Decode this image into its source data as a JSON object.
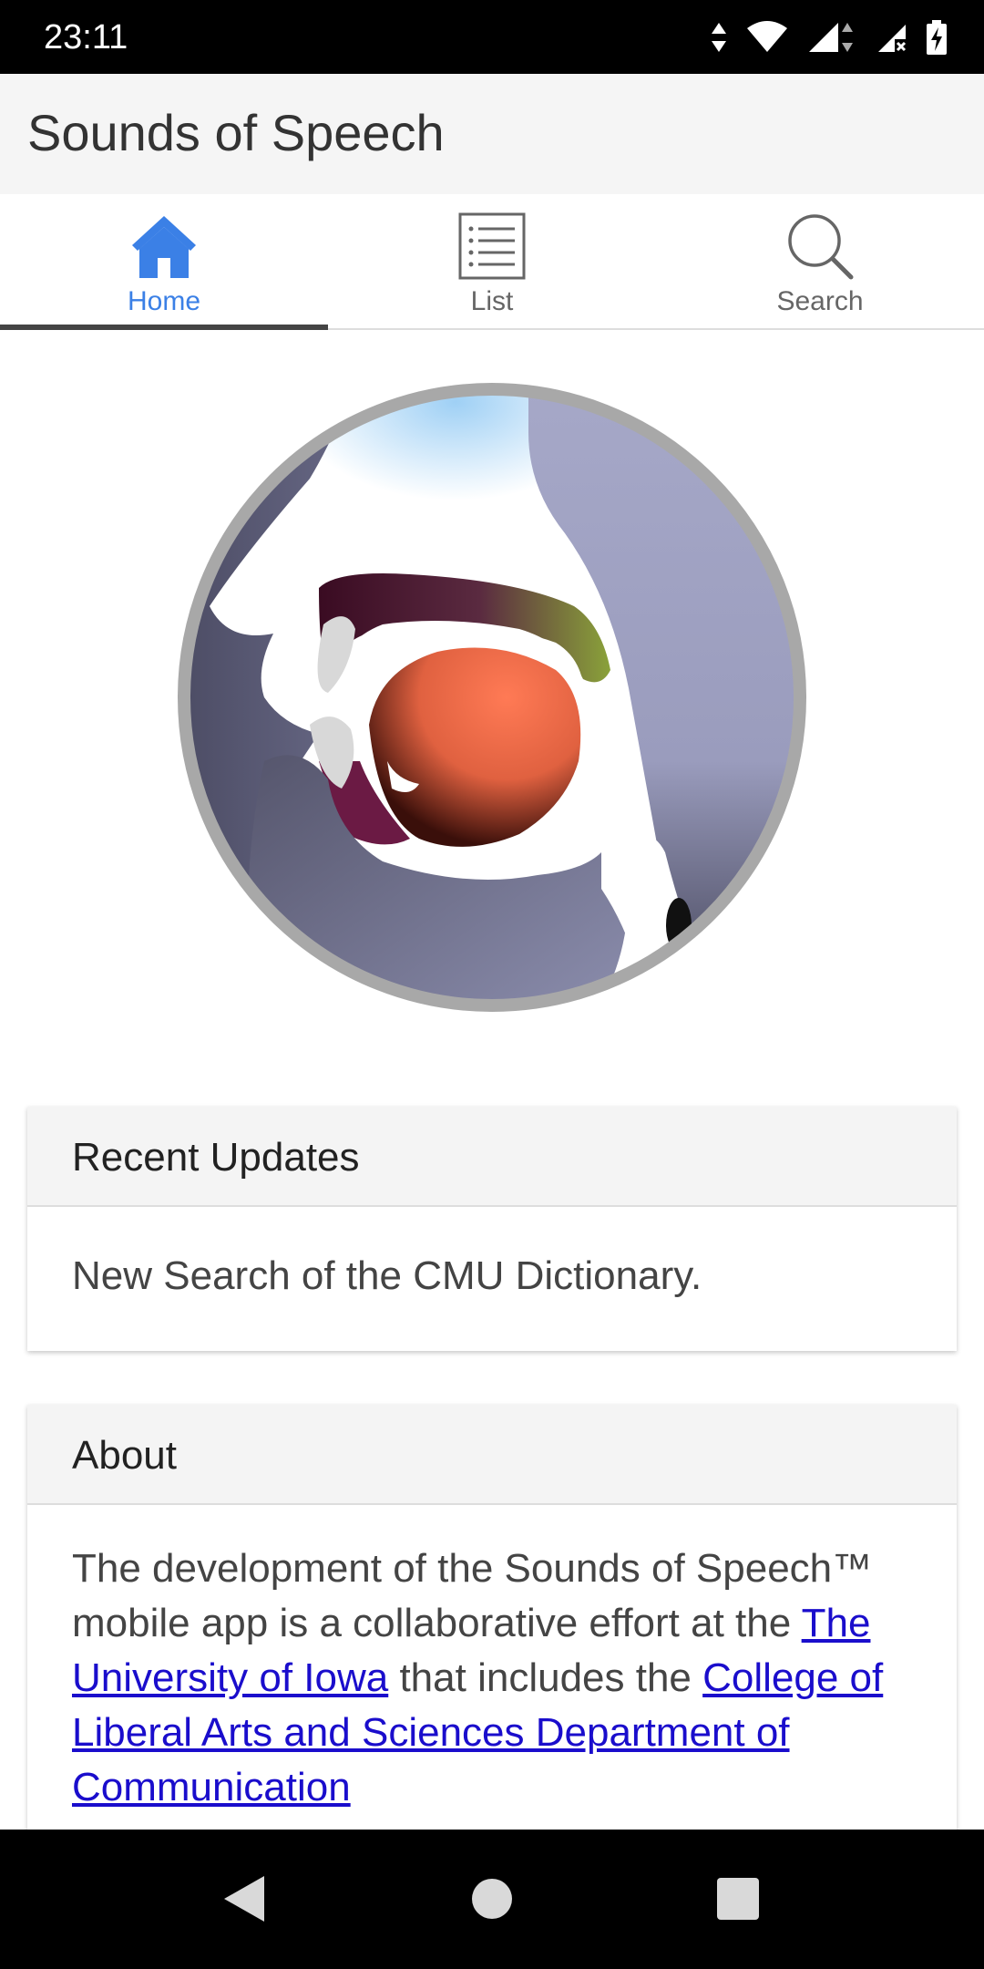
{
  "status_bar": {
    "time": "23:11"
  },
  "app_bar": {
    "title": "Sounds of Speech"
  },
  "tabs": [
    {
      "label": "Home",
      "icon": "home-icon",
      "active": true
    },
    {
      "label": "List",
      "icon": "list-icon",
      "active": false
    },
    {
      "label": "Search",
      "icon": "search-icon",
      "active": false
    }
  ],
  "recent_updates": {
    "title": "Recent Updates",
    "text": "New Search of the CMU Dictionary."
  },
  "about": {
    "title": "About",
    "text_1": "The development of the Sounds of Speech™ mobile app is a collaborative effort at the ",
    "link_1": "The University of Iowa",
    "text_2": " that includes the ",
    "link_2": "College of Liberal Arts and Sciences Department of Communication"
  },
  "colors": {
    "accent": "#3b80e6",
    "link": "#1a0dcc",
    "tab_indicator": "#444444"
  }
}
